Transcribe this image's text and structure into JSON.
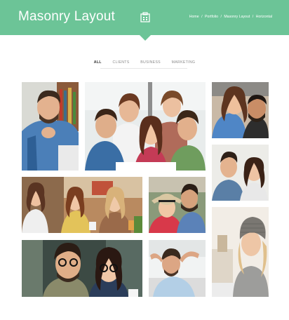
{
  "header": {
    "title": "Masonry Layout",
    "icon": "portfolio-icon",
    "background": "#6cc497"
  },
  "breadcrumb": [
    "Home",
    "Portfolio",
    "Masonry Layout",
    "Horizontal"
  ],
  "breadcrumb_separator": "/",
  "filters": [
    {
      "label": "ALL",
      "active": true
    },
    {
      "label": "CLIENTS",
      "active": false
    },
    {
      "label": "BUSINESS",
      "active": false
    },
    {
      "label": "MARKETING",
      "active": false
    }
  ],
  "gallery": [
    {
      "subject": "man with beard at laptop"
    },
    {
      "subject": "group of five friends"
    },
    {
      "subject": "couple smiling"
    },
    {
      "subject": "couple portrait"
    },
    {
      "subject": "three friends laughing at cafe"
    },
    {
      "subject": "couple with hat outdoors"
    },
    {
      "subject": "woman with beanie"
    },
    {
      "subject": "couple with glasses"
    },
    {
      "subject": "man relaxing on couch"
    }
  ]
}
